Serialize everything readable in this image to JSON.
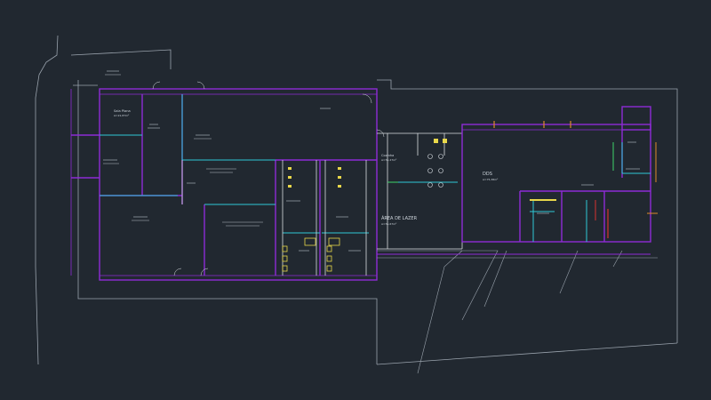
{
  "drawing": {
    "background": "#212830",
    "colors": {
      "site_outline": "#9aa3ad",
      "walls_purple": "#8e2bd6",
      "partitions_cyan": "#2ec9d6",
      "walls_white": "#d8dde2",
      "fixtures_yellow": "#e9d84a",
      "fixtures_orange": "#e08a2a",
      "fixtures_red": "#d8322f",
      "fixtures_green": "#3fd46a",
      "text": "#cfd6dd"
    }
  },
  "rooms": {
    "sala_plana": {
      "label": "Sala Plana",
      "area": "A=21,87m²"
    },
    "cozinha": {
      "label": "Cozinha",
      "area": "A=51,27m²"
    },
    "area_lazer": {
      "label": "ÁREA DE LAZER",
      "area": "A=51,67m²"
    },
    "dds": {
      "label": "DDS",
      "area": "A=75,38m²"
    }
  }
}
